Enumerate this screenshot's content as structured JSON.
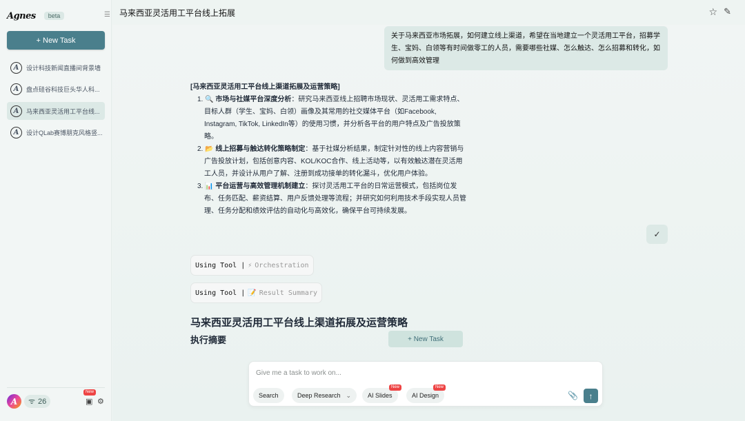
{
  "sidebar": {
    "logo": "Agnes",
    "beta": "beta",
    "collapse_icon": "sidebar-collapse-icon",
    "new_task": "+ New Task",
    "history": [
      {
        "label": "设计科技新闻直播间背景墙"
      },
      {
        "label": "盘点硅谷科技巨头华人科..."
      },
      {
        "label": "马来西亚灵活用工平台线..."
      },
      {
        "label": "设计QLab赛博朋克风格竖..."
      }
    ],
    "credits": "26",
    "new_badge": "New"
  },
  "header": {
    "title": "马来西亚灵活用工平台线上拓展"
  },
  "conversation": {
    "user_message": "关于马来西亚市场拓展，如何建立线上渠道，希望在当地建立一个灵活用工平台，招募学生、宝妈、白领等有时间做零工的人员，需要哪些社媒、怎么触达、怎么招募和转化，如何做到高效管理",
    "plan_heading": "[马来西亚灵活用工平台线上渠道拓展及运营策略]",
    "plan_items": [
      {
        "num": "1.",
        "icon": "🔍",
        "title": "市场与社媒平台深度分析",
        "body": "：研究马来西亚线上招聘市场现状、灵活用工需求特点、目标人群（学生、宝妈、白领）画像及其常用的社交媒体平台（如Facebook, Instagram, TikTok, LinkedIn等）的使用习惯，并分析各平台的用户特点及广告投放策略。"
      },
      {
        "num": "2.",
        "icon": "📂",
        "title": "线上招募与触达转化策略制定",
        "body": "：基于社媒分析结果，制定针对性的线上内容营销与广告投放计划，包括创意内容、KOL/KOC合作、线上活动等，以有效触达潜在灵活用工人员，并设计从用户了解、注册到成功接单的转化漏斗，优化用户体验。"
      },
      {
        "num": "3.",
        "icon": "📊",
        "title": "平台运营与高效管理机制建立",
        "body": "：探讨灵活用工平台的日常运营模式，包括岗位发布、任务匹配、薪资结算、用户反馈处理等流程；并研究如何利用技术手段实现人员管理、任务分配和绩效评估的自动化与高效化，确保平台可持续发展。"
      }
    ],
    "confirm": "✓",
    "tools": [
      {
        "prefix": "Using Tool |",
        "icon": "⚡",
        "name": "Orchestration"
      },
      {
        "prefix": "Using Tool |",
        "icon": "📝",
        "name": "Result Summary"
      }
    ],
    "report_title": "马来西亚灵活用工平台线上渠道拓展及运营策略",
    "section_heading": "执行摘要",
    "floating_new_task": "+ New Task"
  },
  "composer": {
    "placeholder": "Give me a task to work on...",
    "chips": [
      "Search",
      "Deep Research",
      "AI Slides",
      "AI Design"
    ],
    "new_badge": "New"
  },
  "colors": {
    "accent": "#4a7f8c",
    "bubble": "#dce9e6",
    "badge": "#e44444"
  }
}
